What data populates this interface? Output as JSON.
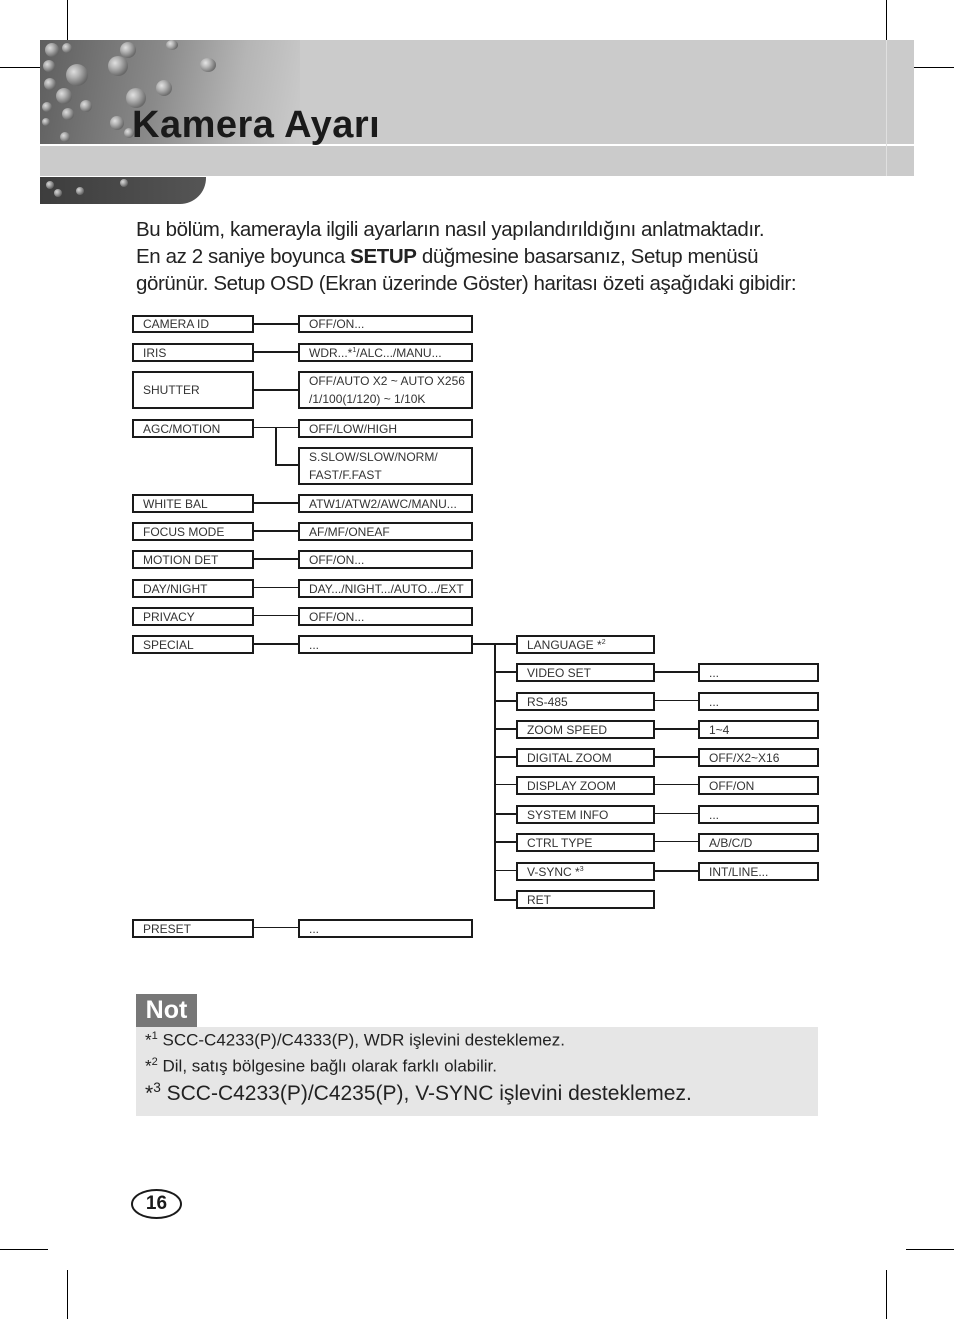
{
  "page": {
    "title": "Kamera Ayarı",
    "page_number": "16"
  },
  "intro": {
    "line1": "Bu bölüm, kamerayla ilgili ayarların nasıl yapılandırıldığını anlatmaktadır.",
    "line2_pre": "En az 2 saniye boyunca ",
    "line2_bold": "SETUP",
    "line2_post": " düğmesine basarsanız, Setup menüsü",
    "line3": "görünür. Setup OSD (Ekran üzerinde Göster) haritası özeti aşağıdaki gibidir:"
  },
  "menu": {
    "main": [
      {
        "label": "CAMERA ID",
        "options": "OFF/ON..."
      },
      {
        "label": "IRIS",
        "options_pre": "WDR...*",
        "options_sup": "1",
        "options_post": "/ALC.../MANU..."
      },
      {
        "label": "SHUTTER",
        "options_line1": "OFF/AUTO X2 ~ AUTO X256",
        "options_line2": "/1/100(1/120) ~ 1/10K"
      },
      {
        "label": "AGC/MOTION",
        "options": "OFF/LOW/HIGH",
        "options2_line1": "S.SLOW/SLOW/NORM/",
        "options2_line2": "FAST/F.FAST"
      },
      {
        "label": "WHITE BAL",
        "options": "ATW1/ATW2/AWC/MANU..."
      },
      {
        "label": "FOCUS MODE",
        "options": "AF/MF/ONEAF"
      },
      {
        "label": "MOTION DET",
        "options": "OFF/ON..."
      },
      {
        "label": "DAY/NIGHT",
        "options": "DAY.../NIGHT.../AUTO.../EXT"
      },
      {
        "label": "PRIVACY",
        "options": "OFF/ON..."
      },
      {
        "label": "SPECIAL",
        "options": "..."
      },
      {
        "label": "PRESET",
        "options": "..."
      }
    ],
    "special": [
      {
        "label": "LANGUAGE *",
        "sup": "2",
        "value": null
      },
      {
        "label": "VIDEO SET",
        "value": "..."
      },
      {
        "label": "RS-485",
        "value": "..."
      },
      {
        "label": "ZOOM SPEED",
        "value": "1~4"
      },
      {
        "label": "DIGITAL ZOOM",
        "value": "OFF/X2~X16"
      },
      {
        "label": "DISPLAY ZOOM",
        "value": "OFF/ON"
      },
      {
        "label": "SYSTEM INFO",
        "value": "..."
      },
      {
        "label": "CTRL TYPE",
        "value": "A/B/C/D"
      },
      {
        "label": "V-SYNC *",
        "sup": "3",
        "value": "INT/LINE..."
      },
      {
        "label": "RET",
        "value": null
      }
    ]
  },
  "note": {
    "heading": "Not",
    "items": [
      {
        "marker": "*",
        "num": "1",
        "text": " SCC-C4233(P)/C4333(P), WDR işlevini desteklemez."
      },
      {
        "marker": "*",
        "num": "2",
        "text": " Dil, satış bölgesine bağlı olarak farklı olabilir."
      },
      {
        "marker": "*",
        "num": "3",
        "text": " SCC-C4233(P)/C4235(P), V-SYNC işlevini desteklemez."
      }
    ]
  }
}
